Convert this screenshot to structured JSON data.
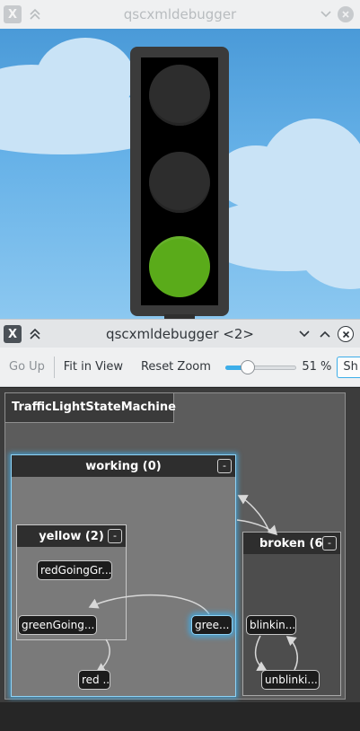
{
  "window1": {
    "title": "qscxmldebugger",
    "app_icon": "X",
    "lamps": [
      {
        "name": "red",
        "lit": false
      },
      {
        "name": "yellow",
        "lit": false
      },
      {
        "name": "green",
        "lit": true
      }
    ],
    "colors": {
      "lit_green": "#5aab1a",
      "lamp_off": "#2d2d2d"
    }
  },
  "window2": {
    "title": "qscxmldebugger <2>",
    "app_icon": "X",
    "toolbar": {
      "go_up": "Go Up",
      "fit_in_view": "Fit in View",
      "reset_zoom": "Reset Zoom",
      "zoom_value": 51,
      "zoom_label": "51 %",
      "cut_button": "Sh"
    },
    "machine": {
      "root": "TrafficLightStateMachine",
      "working": {
        "label": "working (0)",
        "collapse": "-"
      },
      "yellow": {
        "label": "yellow (2)",
        "collapse": "-"
      },
      "broken": {
        "label": "broken (6",
        "collapse": "-"
      },
      "leaves": {
        "red_going_green": "redGoingGr...",
        "green_going": "greenGoing...",
        "green": "gree...",
        "red": "red ...",
        "blinking": "blinkin...",
        "unblinking": "unblinki..."
      }
    },
    "colors": {
      "accent": "#3daee9",
      "canvas": "#3c3c3c"
    }
  }
}
